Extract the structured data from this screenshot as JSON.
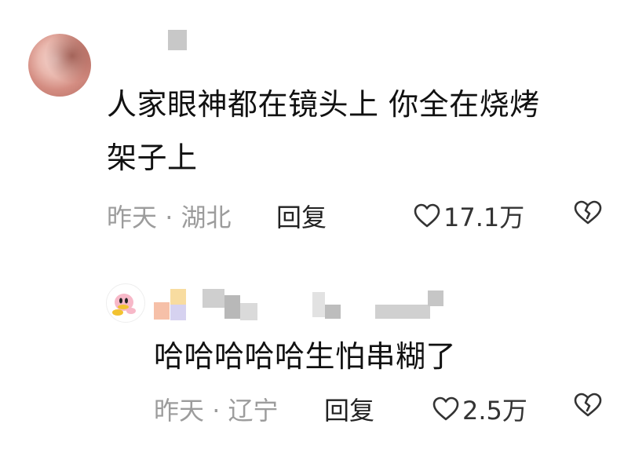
{
  "comments": [
    {
      "avatar_icon": "girl-avatar-icon",
      "text_line1": "人家眼神都在镜头上 你全在烧烤",
      "text_line2": "架子上",
      "time": "昨天",
      "location": "湖北",
      "separator": "·",
      "reply_label": "回复",
      "likes": "17.1万"
    },
    {
      "avatar_icon": "kirby-avatar-icon",
      "text": "哈哈哈哈哈生怕串糊了",
      "time": "昨天",
      "location": "辽宁",
      "separator": "·",
      "reply_label": "回复",
      "likes": "2.5万"
    }
  ],
  "icons": {
    "like": "heart-outline-icon",
    "dislike": "broken-heart-icon"
  },
  "colors": {
    "text": "#111111",
    "meta": "#9c9c9c",
    "background": "#ffffff"
  }
}
